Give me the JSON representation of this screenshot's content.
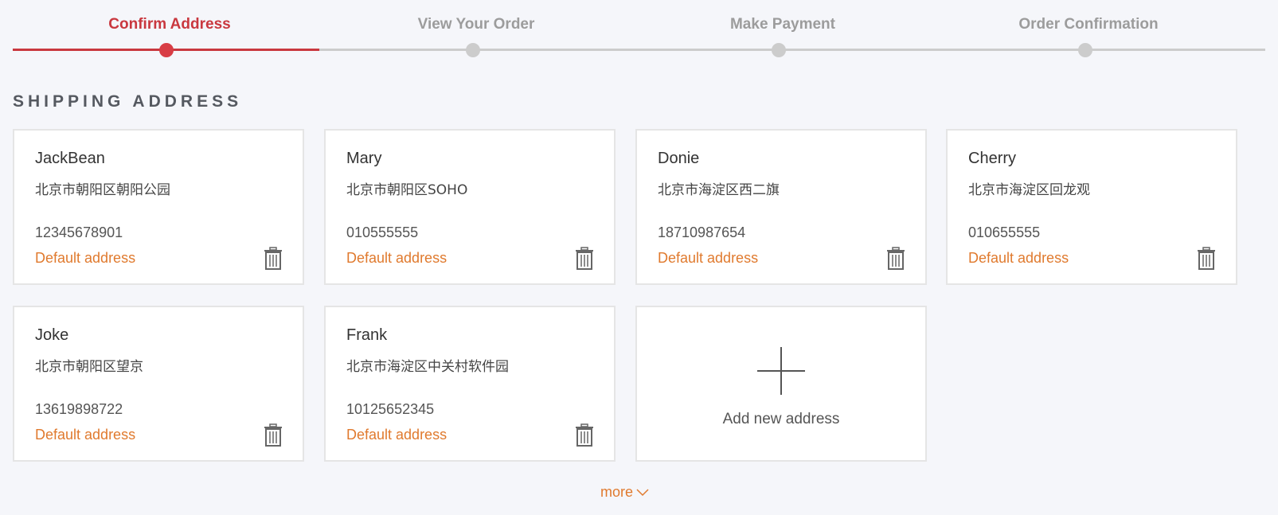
{
  "steps": [
    {
      "label": "Confirm Address",
      "active": true
    },
    {
      "label": "View Your Order",
      "active": false
    },
    {
      "label": "Make Payment",
      "active": false
    },
    {
      "label": "Order Confirmation",
      "active": false
    }
  ],
  "progress_fraction": 0.245,
  "section_title": "SHIPPING ADDRESS",
  "addresses": [
    {
      "name": "JackBean",
      "address": "北京市朝阳区朝阳公园",
      "phone": "12345678901",
      "default_label": "Default address"
    },
    {
      "name": "Mary",
      "address": "北京市朝阳区SOHO",
      "phone": "010555555",
      "default_label": "Default address"
    },
    {
      "name": "Donie",
      "address": "北京市海淀区西二旗",
      "phone": "18710987654",
      "default_label": "Default address"
    },
    {
      "name": "Cherry",
      "address": "北京市海淀区回龙观",
      "phone": "010655555",
      "default_label": "Default address"
    },
    {
      "name": "Joke",
      "address": "北京市朝阳区望京",
      "phone": "13619898722",
      "default_label": "Default address"
    },
    {
      "name": "Frank",
      "address": "北京市海淀区中关村软件园",
      "phone": "10125652345",
      "default_label": "Default address"
    }
  ],
  "add_new_label": "Add new address",
  "more_label": "more",
  "colors": {
    "accent": "#c9383f",
    "orange": "#e07a2e",
    "inactive": "#cccccc"
  },
  "icons": {
    "delete": "trash-icon",
    "add": "plus-icon",
    "expand": "chevron-down-icon"
  }
}
